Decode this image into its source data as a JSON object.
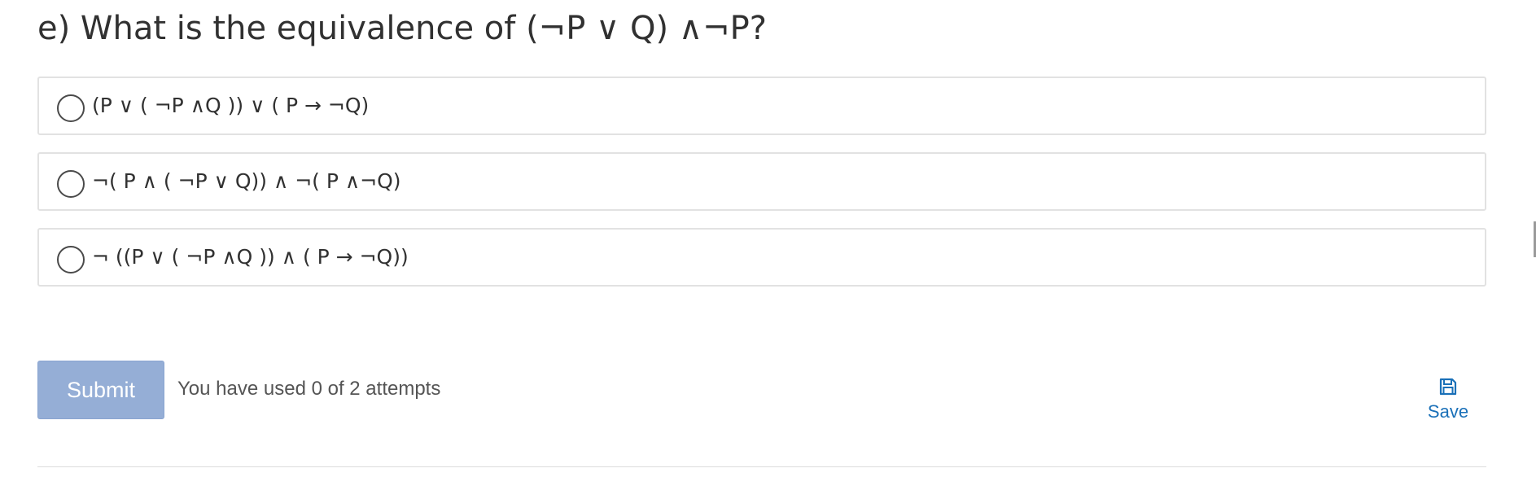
{
  "question": {
    "title": "e) What is the equivalence of (¬P ∨ Q) ∧¬P?"
  },
  "choices": [
    {
      "label": "(P ∨ ( ¬P ∧Q )) ∨ ( P → ¬Q)"
    },
    {
      "label": "¬( P ∧ ( ¬P ∨ Q)) ∧ ¬( P ∧¬Q)"
    },
    {
      "label": "¬ ((P ∨ ( ¬P ∧Q )) ∧ ( P → ¬Q))"
    }
  ],
  "actions": {
    "submit_label": "Submit",
    "attempts_text": "You have used 0 of 2 attempts",
    "save_label": "Save",
    "save_icon": "floppy-disk-icon"
  },
  "colors": {
    "submit_bg": "#95aed6",
    "link": "#1a70b8",
    "border": "#e2e2e2"
  }
}
